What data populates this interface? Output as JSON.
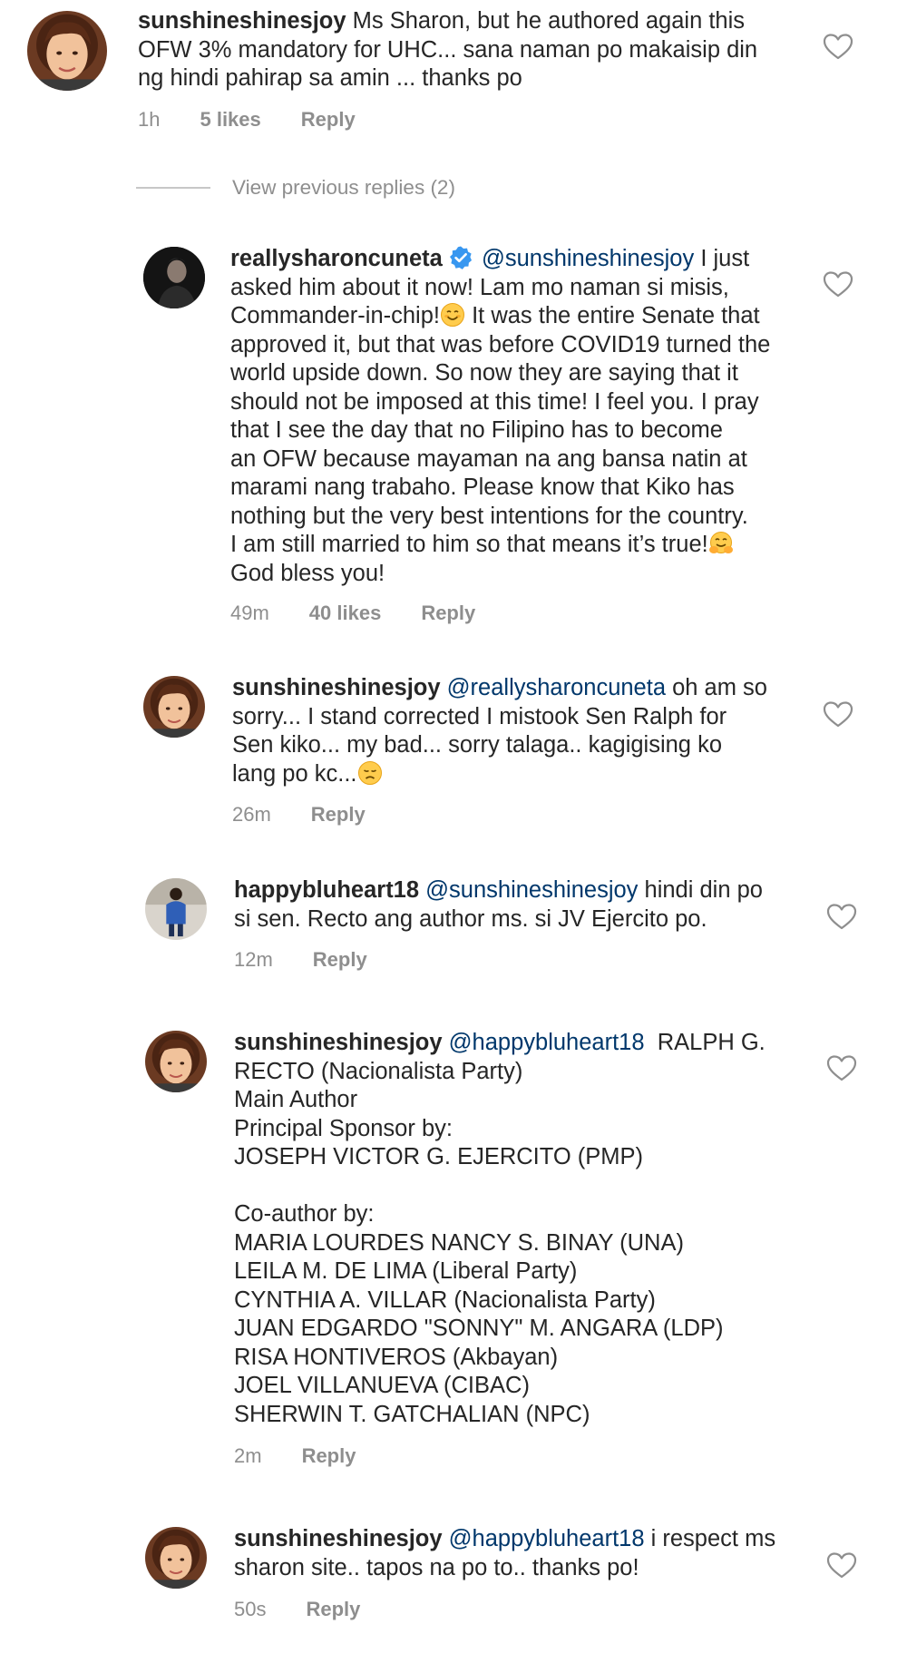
{
  "view_previous": "View previous replies (2)",
  "colors": {
    "text": "#262626",
    "muted": "#8e8e8e",
    "mention": "#00376b",
    "verified": "#3897f0"
  },
  "comments": [
    {
      "username": "sunshineshinesjoy",
      "mention": "",
      "line1": "Ms Sharon, but he authored again this",
      "rest": "OFW 3% mandatory for UHC... sana naman po makaisip din\nng hindi pahirap sa amin ... thanks po",
      "time": "1h",
      "likes": "5 likes",
      "reply": "Reply",
      "avatar": "woman-avatar-icon"
    },
    {
      "username": "reallysharoncuneta",
      "verified": true,
      "mention": "@sunshineshinesjoy",
      "line1": " I just",
      "rest_a": "asked him about it now! Lam mo naman si misis,\nCommander-in-chip!",
      "rest_b": " It was the entire Senate that\napproved it, but that was before COVID19 turned the\nworld upside down. So now they are saying that it\nshould not be imposed at this time! I feel you. I pray\nthat I see the day that no Filipino has to become\nan OFW because mayaman na ang bansa natin at\nmarami nang trabaho. Please know that Kiko has\nnothing but the very best intentions for the country.\nI am still married to him so that means it’s true!",
      "rest_c": "\nGod bless you!",
      "time": "49m",
      "likes": "40 likes",
      "reply": "Reply",
      "avatar": "dark-profile-avatar-icon"
    },
    {
      "username": "sunshineshinesjoy",
      "mention": "@reallysharoncuneta",
      "line1": " oh am so",
      "rest": "sorry... I stand corrected I mistook Sen Ralph for\nSen kiko... my bad... sorry talaga.. kagigising ko\nlang po kc...",
      "time": "26m",
      "reply": "Reply",
      "avatar": "woman-avatar-icon"
    },
    {
      "username": "happybluheart18",
      "mention": "@sunshineshinesjoy",
      "line1": " hindi din po",
      "rest": "si sen. Recto ang author ms. si JV Ejercito po.",
      "time": "12m",
      "reply": "Reply",
      "avatar": "standing-person-avatar-icon"
    },
    {
      "username": "sunshineshinesjoy",
      "mention": "@happybluheart18",
      "line1": "  RALPH G.",
      "rest": "RECTO (Nacionalista Party)\nMain Author\nPrincipal Sponsor by:\nJOSEPH VICTOR G. EJERCITO (PMP)\n\nCo-author by:\nMARIA LOURDES NANCY S. BINAY (UNA)\nLEILA M. DE LIMA (Liberal Party)\nCYNTHIA A. VILLAR (Nacionalista Party)\nJUAN EDGARDO \"SONNY\" M. ANGARA (LDP)\nRISA HONTIVEROS (Akbayan)\nJOEL VILLANUEVA (CIBAC)\nSHERWIN T. GATCHALIAN (NPC)",
      "time": "2m",
      "reply": "Reply",
      "avatar": "woman-avatar-icon"
    },
    {
      "username": "sunshineshinesjoy",
      "mention": "@happybluheart18",
      "line1": " i respect ms",
      "rest": "sharon site.. tapos na po to.. thanks po!",
      "time": "50s",
      "reply": "Reply",
      "avatar": "woman-avatar-icon"
    }
  ]
}
